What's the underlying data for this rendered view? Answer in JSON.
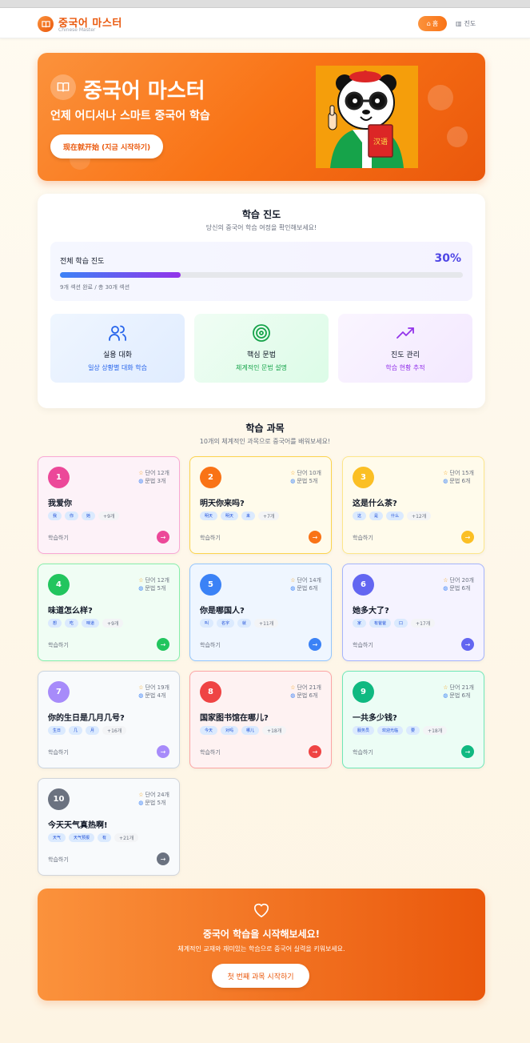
{
  "nav": {
    "title": "중국어 마스터",
    "subtitle": "Chinese Master",
    "home_label": "홈",
    "progress_label": "진도"
  },
  "hero": {
    "title": "중국어 마스터",
    "subtitle": "언제 어디서나 스마트 중국어 학습",
    "button": "现在就开始 (지금 시작하기)",
    "book_text": "汉语"
  },
  "progress": {
    "title": "학습 진도",
    "subtitle": "당신의 중국어 학습 여정을 확인해보세요!",
    "overall_label": "전체 학습 진도",
    "percent_text": "30%",
    "percent": 0.3,
    "detail": "9개 섹션 완료 / 총 30개 섹션",
    "features": [
      {
        "title": "실용 대화",
        "sub": "일상 상황별 대화 학습",
        "icon": "users-icon",
        "color": "#2563eb"
      },
      {
        "title": "핵심 문법",
        "sub": "체계적인 문법 설명",
        "icon": "target-icon",
        "color": "#16a34a"
      },
      {
        "title": "진도 관리",
        "sub": "학습 현황 추적",
        "icon": "trending-up-icon",
        "color": "#9333ea"
      }
    ]
  },
  "courses": {
    "title": "학습 과목",
    "subtitle": "10개의 체계적인 과목으로 중국어를 배워보세요!",
    "items": [
      {
        "num": "1",
        "words": "단어 12개",
        "grammar": "문법 3개",
        "title": "我爱你",
        "tags": [
          "我",
          "你",
          "她"
        ],
        "more": "+9개",
        "study": "학습하기",
        "arrow": "→",
        "color": "#ec4899",
        "bg": "#fdf2f8",
        "border": "#f9a8d4"
      },
      {
        "num": "2",
        "words": "단어 10개",
        "grammar": "문법 5개",
        "title": "明天你来吗?",
        "tags": [
          "明天",
          "明天",
          "来"
        ],
        "more": "+7개",
        "study": "학습하기",
        "arrow": "→",
        "color": "#f97316",
        "bg": "#fffbeb",
        "border": "#fcd34d"
      },
      {
        "num": "3",
        "words": "단어 15개",
        "grammar": "문법 6개",
        "title": "这是什么茶?",
        "tags": [
          "这",
          "是",
          "什么"
        ],
        "more": "+12개",
        "study": "학습하기",
        "arrow": "→",
        "color": "#fbbf24",
        "bg": "#fffbeb",
        "border": "#fde68a"
      },
      {
        "num": "4",
        "words": "단어 12개",
        "grammar": "문법 5개",
        "title": "味道怎么样?",
        "tags": [
          "想",
          "吃",
          "味道"
        ],
        "more": "+9개",
        "study": "학습하기",
        "arrow": "→",
        "color": "#22c55e",
        "bg": "#f0fdf4",
        "border": "#86efac"
      },
      {
        "num": "5",
        "words": "단어 14개",
        "grammar": "문법 6개",
        "title": "你是哪国人?",
        "tags": [
          "叫",
          "名字",
          "就"
        ],
        "more": "+11개",
        "study": "학습하기",
        "arrow": "→",
        "color": "#3b82f6",
        "bg": "#eff6ff",
        "border": "#93c5fd"
      },
      {
        "num": "6",
        "words": "단어 20개",
        "grammar": "문법 6개",
        "title": "她多大了?",
        "tags": [
          "家",
          "有爸爸",
          "口"
        ],
        "more": "+17개",
        "study": "학습하기",
        "arrow": "→",
        "color": "#6366f1",
        "bg": "#f5f3ff",
        "border": "#a5b4fc"
      },
      {
        "num": "7",
        "words": "단어 19개",
        "grammar": "문법 4개",
        "title": "你的生日是几月几号?",
        "tags": [
          "生日",
          "几",
          "月"
        ],
        "more": "+16개",
        "study": "학습하기",
        "arrow": "→",
        "color": "#a78bfa",
        "bg": "#f8fafc",
        "border": "#cbd5e1"
      },
      {
        "num": "8",
        "words": "단어 21개",
        "grammar": "문법 6개",
        "title": "国家图书馆在哪儿?",
        "tags": [
          "今天",
          "对吗",
          "哪儿"
        ],
        "more": "+18개",
        "study": "학습하기",
        "arrow": "→",
        "color": "#ef4444",
        "bg": "#fef2f2",
        "border": "#fca5a5"
      },
      {
        "num": "9",
        "words": "단어 21개",
        "grammar": "문법 6개",
        "title": "一共多少钱?",
        "tags": [
          "服务员",
          "欢迎光临",
          "要"
        ],
        "more": "+18개",
        "study": "학습하기",
        "arrow": "→",
        "color": "#10b981",
        "bg": "#ecfdf5",
        "border": "#6ee7b7"
      },
      {
        "num": "10",
        "words": "단어 24개",
        "grammar": "문법 5개",
        "title": "今天天气真热啊!",
        "tags": [
          "天气",
          "天气预报",
          "有"
        ],
        "more": "+21개",
        "study": "학습하기",
        "arrow": "→",
        "color": "#6b7280",
        "bg": "#f8fafc",
        "border": "#d1d5db"
      }
    ]
  },
  "cta": {
    "title": "중국어 학습을 시작해보세요!",
    "subtitle": "체계적인 교재와 재미있는 학습으로 중국어 실력을 키워보세요.",
    "button": "첫 번째 과목 시작하기"
  }
}
